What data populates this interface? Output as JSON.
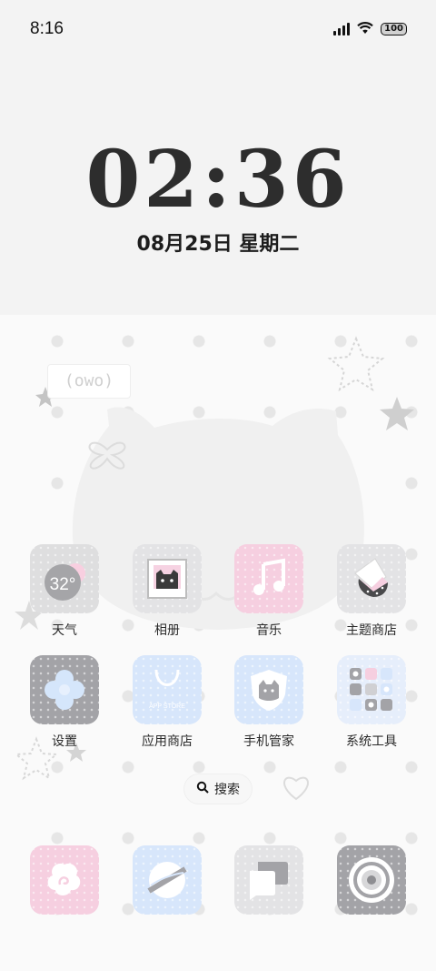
{
  "status_bar": {
    "time": "8:16",
    "battery": "100"
  },
  "lockclock": {
    "time": "02:36",
    "date": "08月25日 星期二"
  },
  "widget": {
    "owo": "(owo)"
  },
  "apps_row1": [
    {
      "label": "天气",
      "temp": "32°"
    },
    {
      "label": "相册"
    },
    {
      "label": "音乐"
    },
    {
      "label": "主题商店"
    }
  ],
  "apps_row2": [
    {
      "label": "设置"
    },
    {
      "label": "应用商店",
      "sub": "APP STORE"
    },
    {
      "label": "手机管家"
    },
    {
      "label": "系统工具"
    }
  ],
  "search": {
    "label": "搜索"
  },
  "dock": [
    {
      "name": "dock-app-1"
    },
    {
      "name": "browser"
    },
    {
      "name": "messages"
    },
    {
      "name": "camera"
    }
  ],
  "colors": {
    "pink": "#f6cfe0",
    "blue": "#d7e6fb",
    "gray": "#e3e3e5",
    "dark": "#a2a2a6"
  }
}
